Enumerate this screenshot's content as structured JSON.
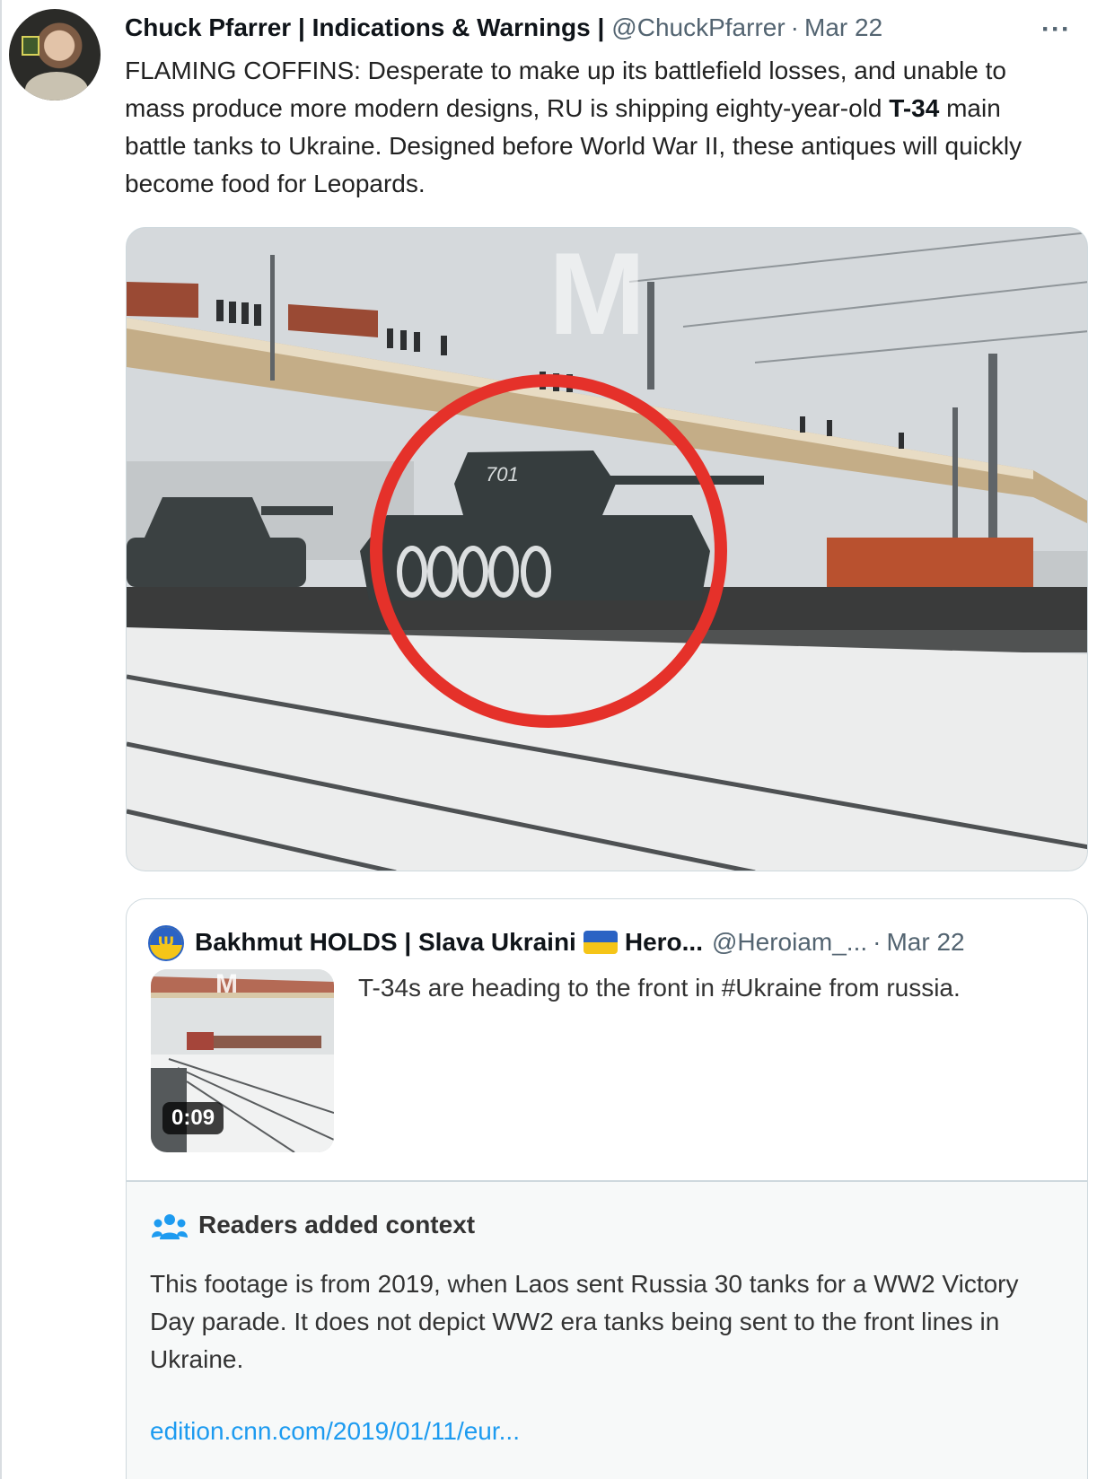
{
  "tweet": {
    "author_name": "Chuck Pfarrer | Indications & Warnings |",
    "handle": "@ChuckPfarrer",
    "separator": "·",
    "date": "Mar 22",
    "more_label": "···",
    "text_part1": "FLAMING COFFINS:   Desperate to make up its  battlefield losses, and unable to mass produce more modern designs, RU is shipping eighty-year-old ",
    "text_bold": "T-34",
    "text_part2": " main battle tanks to Ukraine.  Designed before World War II, these antiques will quickly become food for Leopards.",
    "media": {
      "watermark": "M",
      "tank_marking": "701",
      "accent_circle_color": "#e5312a"
    }
  },
  "quote": {
    "author_name": "Bakhmut HOLDS | Slava Ukraini",
    "name_suffix": "Hero...",
    "handle": "@Heroiam_...",
    "separator": "·",
    "date": "Mar 22",
    "text": "T-34s are heading to the front in #Ukraine from russia.",
    "thumbnail": {
      "watermark": "M",
      "duration": "0:09"
    }
  },
  "context": {
    "title": "Readers added context",
    "text": "This footage is from 2019, when Laos sent Russia 30 tanks for a WW2 Victory Day parade. It does not depict WW2 era tanks being sent to the front lines in Ukraine.",
    "link": "edition.cnn.com/2019/01/11/eur...",
    "link_color": "#1d9bf0"
  }
}
